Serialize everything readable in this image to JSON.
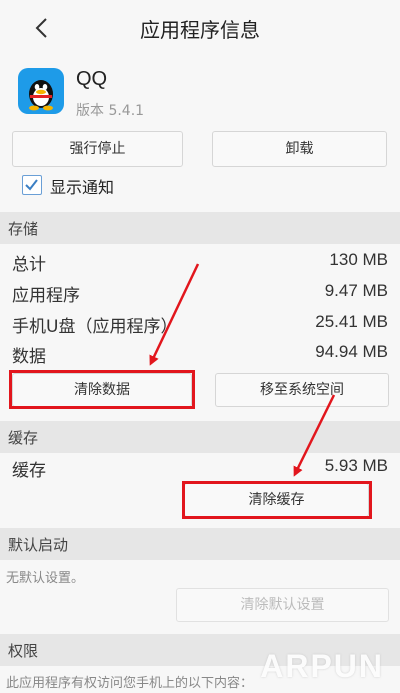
{
  "header": {
    "title": "应用程序信息",
    "back_icon": "chevron-left-icon"
  },
  "app": {
    "name": "QQ",
    "version": "版本 5.4.1",
    "icon": "qq-penguin-icon",
    "icon_color": "#1e9be8"
  },
  "actions": {
    "force_stop": "强行停止",
    "uninstall": "卸载"
  },
  "notification": {
    "label": "显示通知",
    "checked": true
  },
  "storage": {
    "header": "存储",
    "rows": [
      {
        "label": "总计",
        "value": "130 MB"
      },
      {
        "label": "应用程序",
        "value": "9.47 MB"
      },
      {
        "label": "手机U盘（应用程序）",
        "value": "25.41 MB"
      },
      {
        "label": "数据",
        "value": "94.94 MB"
      }
    ],
    "clear_data": "清除数据",
    "move": "移至系统空间"
  },
  "cache": {
    "header": "缓存",
    "label": "缓存",
    "value": "5.93 MB",
    "clear_cache": "清除缓存"
  },
  "defaults": {
    "header": "默认启动",
    "text": "无默认设置。",
    "clear_defaults": "清除默认设置"
  },
  "permissions": {
    "header": "权限",
    "text": "此应用程序有权访问您手机上的以下内容："
  },
  "annotation_color": "#e2161d",
  "watermark": "ARPUN"
}
